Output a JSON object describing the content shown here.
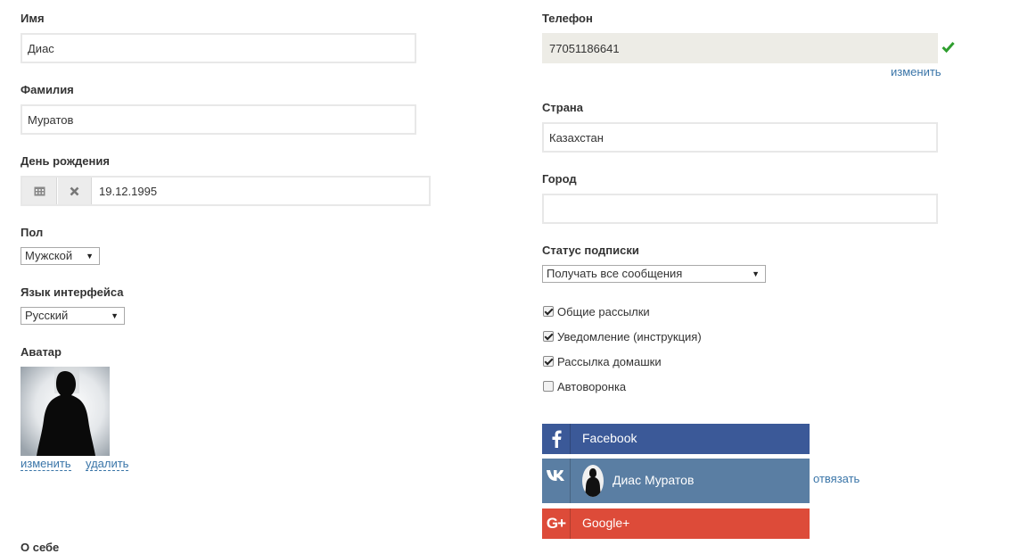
{
  "left": {
    "first_name": {
      "label": "Имя",
      "value": "Диас"
    },
    "last_name": {
      "label": "Фамилия",
      "value": "Муратов"
    },
    "birthday": {
      "label": "День рождения",
      "value": "19.12.1995"
    },
    "gender": {
      "label": "Пол",
      "selected": "Мужской"
    },
    "language": {
      "label": "Язык интерфейса",
      "selected": "Русский"
    },
    "avatar": {
      "label": "Аватар",
      "change_link": "изменить",
      "delete_link": "удалить"
    },
    "about": {
      "label": "О себе"
    }
  },
  "right": {
    "phone": {
      "label": "Телефон",
      "value": "77051186641",
      "change_link": "изменить"
    },
    "country": {
      "label": "Страна",
      "value": "Казахстан"
    },
    "city": {
      "label": "Город",
      "value": ""
    },
    "subscription": {
      "label": "Статус подписки",
      "selected": "Получать все сообщения",
      "options": [
        {
          "label": "Общие рассылки",
          "checked": true
        },
        {
          "label": "Уведомление (инструкция)",
          "checked": true
        },
        {
          "label": "Рассылка домашки",
          "checked": true
        },
        {
          "label": "Автоворонка",
          "checked": false
        }
      ]
    },
    "social": {
      "facebook": {
        "label": "Facebook",
        "color": "#3b5998"
      },
      "vk": {
        "user_name": "Диас Муратов",
        "unlink": "отвязать",
        "color": "#5a7ea3"
      },
      "google": {
        "label": "Google+",
        "color": "#dd4b39"
      }
    }
  },
  "colors": {
    "accent_link": "#3a75a8",
    "verified_check": "#2e9e2e"
  }
}
